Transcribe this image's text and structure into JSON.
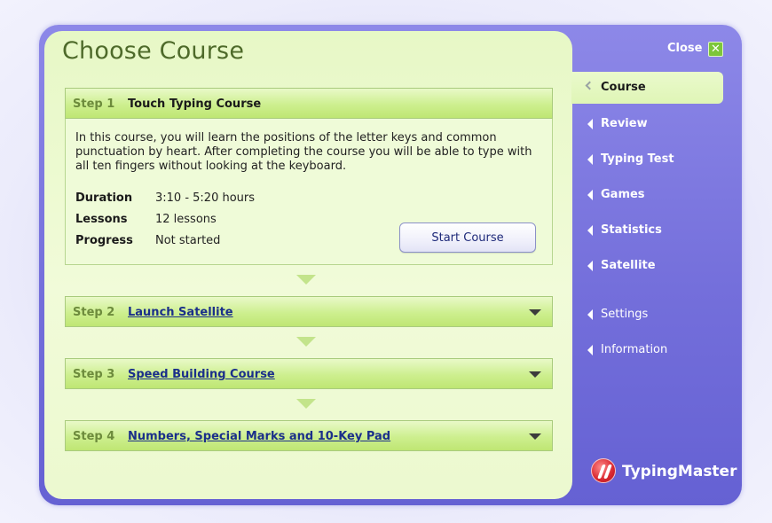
{
  "header": {
    "title": "Choose Course"
  },
  "sidebar": {
    "close_label": "Close",
    "close_icon": "✕",
    "active_item": {
      "label": "Course"
    },
    "items": [
      {
        "label": "Review"
      },
      {
        "label": "Typing Test"
      },
      {
        "label": "Games"
      },
      {
        "label": "Statistics"
      },
      {
        "label": "Satellite"
      },
      {
        "label": "Settings"
      },
      {
        "label": "Information"
      }
    ],
    "logo_text": "TypingMaster"
  },
  "steps": [
    {
      "number": "Step 1",
      "title": "Touch Typing Course",
      "description": "In this course, you will learn the positions of the letter keys and common punctuation by heart. After completing the course you will be able to type with all ten fingers without looking at the keyboard.",
      "duration_label": "Duration",
      "duration_value": "3:10 - 5:20 hours",
      "lessons_label": "Lessons",
      "lessons_value": "12 lessons",
      "progress_label": "Progress",
      "progress_value": "Not started",
      "button_label": "Start Course"
    },
    {
      "number": "Step 2",
      "title": "Launch Satellite"
    },
    {
      "number": "Step 3",
      "title": "Speed Building Course"
    },
    {
      "number": "Step 4",
      "title": "Numbers, Special Marks and 10-Key Pad"
    }
  ],
  "colors": {
    "accent_green": "#7dc63b",
    "frame_purple": "#746fdb",
    "content_bg": "#e7f8c6"
  }
}
